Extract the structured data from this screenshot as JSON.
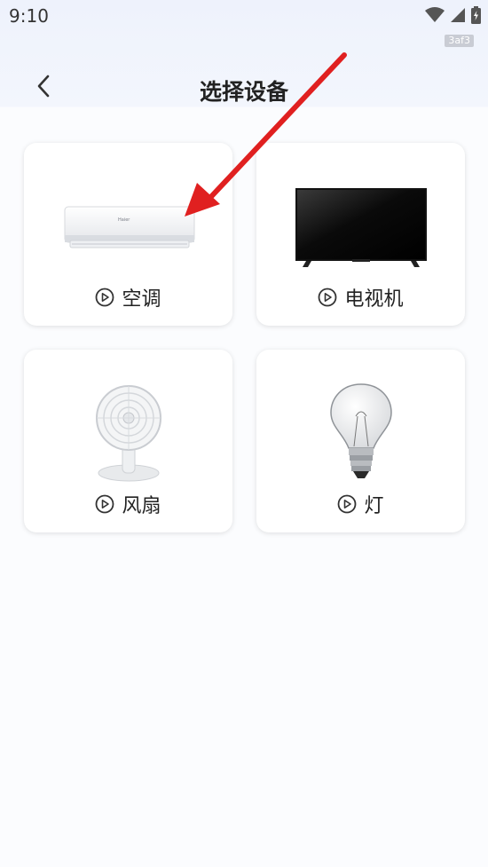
{
  "status_bar": {
    "time": "9:10",
    "tag": "3af3",
    "icons": [
      "wifi-icon",
      "signal-icon",
      "battery-icon"
    ]
  },
  "header": {
    "back_icon": "chevron-left-icon",
    "title": "选择设备"
  },
  "devices": [
    {
      "label": "空调",
      "image": "air-conditioner-image"
    },
    {
      "label": "电视机",
      "image": "television-image"
    },
    {
      "label": "风扇",
      "image": "fan-image"
    },
    {
      "label": "灯",
      "image": "light-bulb-image"
    }
  ],
  "colors": {
    "annotation_arrow": "#e02020",
    "title_text": "#222222",
    "card_background": "#ffffff",
    "page_background": "#fbfcfe"
  }
}
